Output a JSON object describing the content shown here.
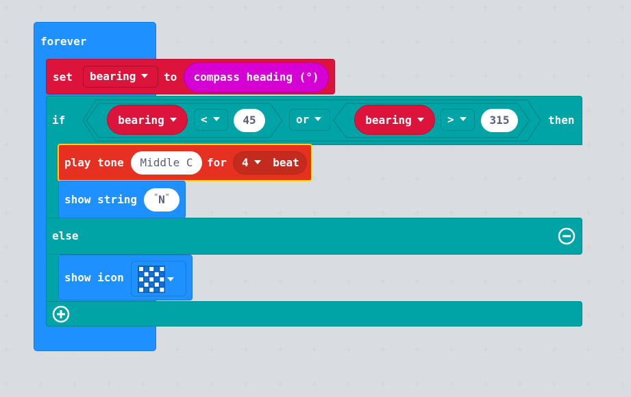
{
  "blocks": {
    "forever": {
      "label": "forever"
    },
    "set": {
      "label": "set",
      "variable": "bearing",
      "to_label": "to",
      "value": "compass heading (°)"
    },
    "if": {
      "if_label": "if",
      "left": {
        "variable": "bearing",
        "operator": "<",
        "value": "45"
      },
      "or_label": "or",
      "right": {
        "variable": "bearing",
        "operator": ">",
        "value": "315"
      },
      "then_label": "then"
    },
    "play_tone": {
      "label": "play tone",
      "note": "Middle C",
      "for_label": "for",
      "beats": "4",
      "beat_label": "beat"
    },
    "show_string": {
      "label": "show string",
      "open_quote": "\"",
      "value": "N",
      "close_quote": "\""
    },
    "else": {
      "label": "else"
    },
    "show_icon": {
      "label": "show icon"
    }
  },
  "colors": {
    "basic": "#1e90ff",
    "variables": "#dc143c",
    "logic": "#00a4a6",
    "music": "#e63022",
    "input": "#d400d4",
    "selected_outline": "#ffd800"
  },
  "icons": {
    "minus": "minus-circle-icon",
    "plus": "plus-circle-icon",
    "dropdown": "caret-down-icon"
  },
  "icon_grid": [
    [
      1,
      0,
      1,
      0,
      1
    ],
    [
      0,
      1,
      0,
      1,
      0
    ],
    [
      1,
      0,
      1,
      0,
      1
    ],
    [
      0,
      1,
      0,
      1,
      0
    ],
    [
      1,
      0,
      1,
      0,
      1
    ]
  ]
}
